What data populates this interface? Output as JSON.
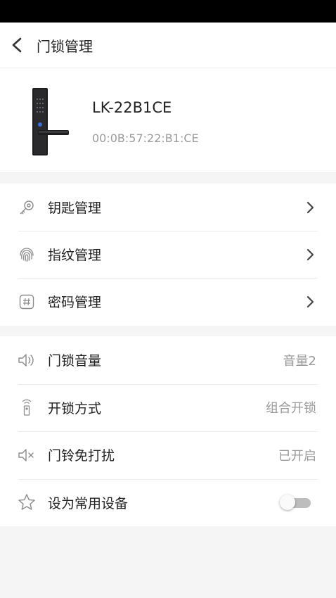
{
  "nav": {
    "title": "门锁管理"
  },
  "device": {
    "name": "LK-22B1CE",
    "mac": "00:0B:57:22:B1:CE"
  },
  "menu_group1": [
    {
      "icon": "key-icon",
      "label": "钥匙管理"
    },
    {
      "icon": "fingerprint-icon",
      "label": "指纹管理"
    },
    {
      "icon": "password-icon",
      "label": "密码管理"
    }
  ],
  "settings": [
    {
      "icon": "volume-icon",
      "label": "门锁音量",
      "value": "音量2"
    },
    {
      "icon": "unlock-mode-icon",
      "label": "开锁方式",
      "value": "组合开锁"
    },
    {
      "icon": "mute-icon",
      "label": "门铃免打扰",
      "value": "已开启"
    },
    {
      "icon": "star-icon",
      "label": "设为常用设备",
      "toggle_on": false
    }
  ],
  "colors": {
    "text": "#222222",
    "secondary": "#9a9a9a",
    "divider": "#ececec",
    "toggle_off": "#bdbdbd"
  }
}
